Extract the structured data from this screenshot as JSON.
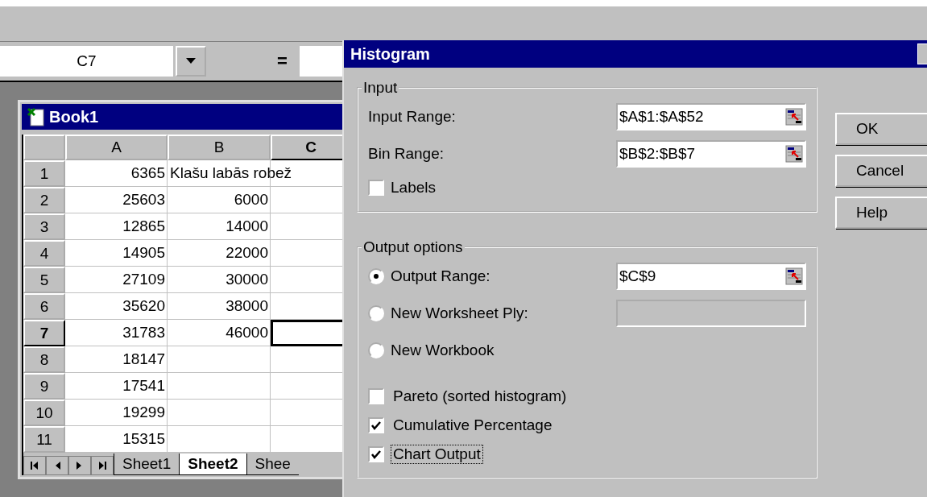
{
  "formula_bar": {
    "name_box": "C7",
    "equals": "="
  },
  "workbook": {
    "title": "Book1",
    "columns": [
      {
        "label": "A",
        "selected": false
      },
      {
        "label": "B",
        "selected": false
      },
      {
        "label": "C",
        "selected": true
      }
    ],
    "rows": [
      {
        "header": "1",
        "selected": false,
        "cells": [
          "6365",
          "Klašu labās robež",
          ""
        ]
      },
      {
        "header": "2",
        "selected": false,
        "cells": [
          "25603",
          "6000",
          ""
        ]
      },
      {
        "header": "3",
        "selected": false,
        "cells": [
          "12865",
          "14000",
          ""
        ]
      },
      {
        "header": "4",
        "selected": false,
        "cells": [
          "14905",
          "22000",
          ""
        ]
      },
      {
        "header": "5",
        "selected": false,
        "cells": [
          "27109",
          "30000",
          ""
        ]
      },
      {
        "header": "6",
        "selected": false,
        "cells": [
          "35620",
          "38000",
          ""
        ]
      },
      {
        "header": "7",
        "selected": true,
        "cells": [
          "31783",
          "46000",
          ""
        ]
      },
      {
        "header": "8",
        "selected": false,
        "cells": [
          "18147",
          "",
          ""
        ]
      },
      {
        "header": "9",
        "selected": false,
        "cells": [
          "17541",
          "",
          ""
        ]
      },
      {
        "header": "10",
        "selected": false,
        "cells": [
          "19299",
          "",
          ""
        ]
      },
      {
        "header": "11",
        "selected": false,
        "cells": [
          "15315",
          "",
          ""
        ]
      }
    ],
    "sheet_tabs": [
      {
        "label": "Sheet1",
        "selected": false
      },
      {
        "label": "Sheet2",
        "selected": true
      },
      {
        "label": "Shee",
        "selected": false
      }
    ]
  },
  "dialog": {
    "title": "Histogram",
    "input": {
      "legend": "Input",
      "fields": [
        {
          "label": "Input Range:",
          "value": "$A$1:$A$52"
        },
        {
          "label": "Bin Range:",
          "value": "$B$2:$B$7"
        }
      ],
      "labels": {
        "label": "Labels",
        "checked": false
      }
    },
    "output": {
      "legend": "Output options",
      "options": [
        {
          "label": "Output Range:",
          "selected": true,
          "field": {
            "value": "$C$9",
            "disabled": false
          }
        },
        {
          "label": "New Worksheet Ply:",
          "selected": false,
          "field": {
            "disabled": true
          }
        },
        {
          "label": "New Workbook",
          "selected": false
        }
      ],
      "checks": [
        {
          "label": "Pareto (sorted histogram)",
          "checked": false,
          "focused": false
        },
        {
          "label": "Cumulative Percentage",
          "checked": true,
          "focused": false
        },
        {
          "label": "Chart Output",
          "checked": true,
          "focused": true
        }
      ]
    },
    "buttons": [
      "OK",
      "Cancel",
      "Help"
    ]
  }
}
